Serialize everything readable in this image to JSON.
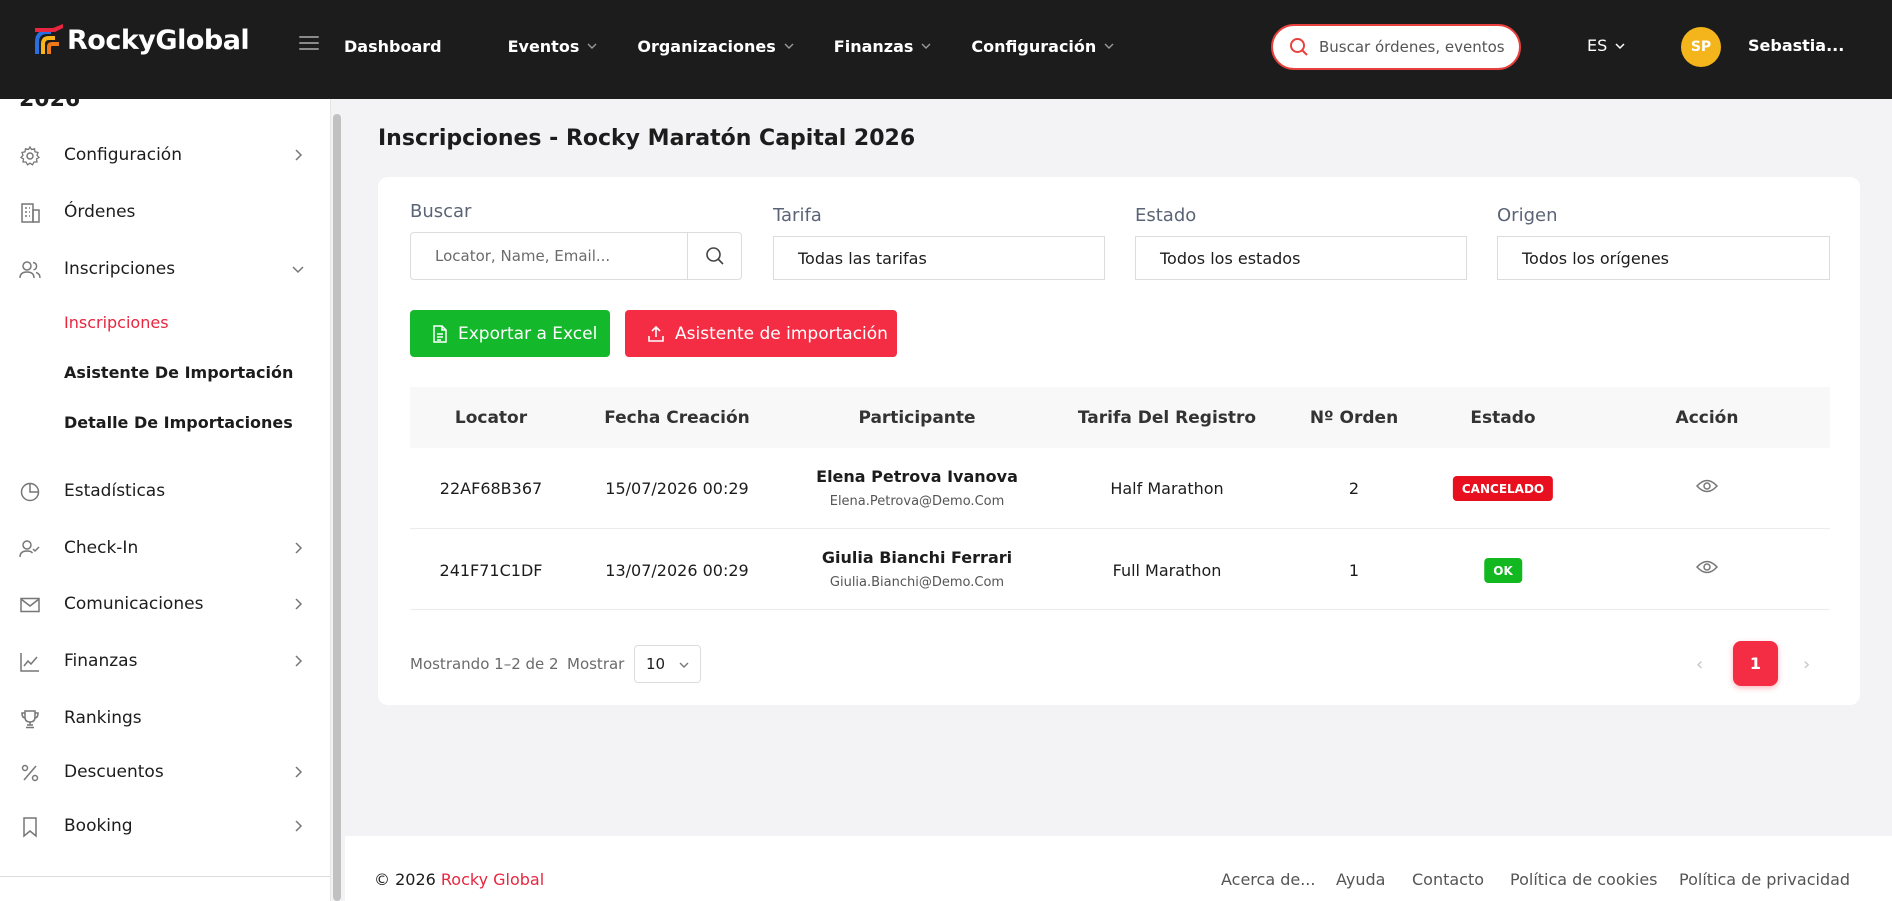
{
  "header": {
    "brand": "RockyGlobal",
    "nav": [
      {
        "label": "Dashboard"
      },
      {
        "label": "Eventos"
      },
      {
        "label": "Organizaciones"
      },
      {
        "label": "Finanzas"
      },
      {
        "label": "Configuración"
      }
    ],
    "search_placeholder": "Buscar órdenes, eventos",
    "language": "ES",
    "avatar_initials": "SP",
    "username": "Sebastia..."
  },
  "sidebar": {
    "cut_title": "2026",
    "items": [
      {
        "label": "Configuración",
        "icon": "gear-icon"
      },
      {
        "label": "Órdenes",
        "icon": "building-icon"
      },
      {
        "label": "Inscripciones",
        "icon": "users-icon"
      },
      {
        "label": "Estadísticas",
        "icon": "pie-chart-icon"
      },
      {
        "label": "Check-In",
        "icon": "user-check-icon"
      },
      {
        "label": "Comunicaciones",
        "icon": "mail-icon"
      },
      {
        "label": "Finanzas",
        "icon": "line-chart-icon"
      },
      {
        "label": "Rankings",
        "icon": "trophy-icon"
      },
      {
        "label": "Descuentos",
        "icon": "percent-icon"
      },
      {
        "label": "Booking",
        "icon": "bookmark-icon"
      }
    ],
    "subitems": [
      {
        "label": "Inscripciones"
      },
      {
        "label": "Asistente De Importación"
      },
      {
        "label": "Detalle De Importaciones"
      }
    ]
  },
  "page": {
    "title": "Inscripciones - Rocky Maratón Capital 2026"
  },
  "filters": {
    "search_label": "Buscar",
    "search_placeholder": "Locator, Name, Email...",
    "tarifa_label": "Tarifa",
    "tarifa_value": "Todas las tarifas",
    "estado_label": "Estado",
    "estado_value": "Todos los estados",
    "origen_label": "Origen",
    "origen_value": "Todos los orígenes"
  },
  "actions": {
    "export_label": "Exportar a Excel",
    "import_label": "Asistente de importación"
  },
  "table": {
    "headers": [
      "Locator",
      "Fecha Creación",
      "Participante",
      "Tarifa Del Registro",
      "Nº Orden",
      "Estado",
      "Acción"
    ],
    "rows": [
      {
        "locator": "22AF68B367",
        "fecha": "15/07/2026 00:29",
        "name": "Elena Petrova Ivanova",
        "email": "Elena.Petrova@Demo.Com",
        "tarifa": "Half Marathon",
        "orden": "2",
        "estado": "CANCELADO"
      },
      {
        "locator": "241F71C1DF",
        "fecha": "13/07/2026 00:29",
        "name": "Giulia Bianchi Ferrari",
        "email": "Giulia.Bianchi@Demo.Com",
        "tarifa": "Full Marathon",
        "orden": "1",
        "estado": "OK"
      }
    ]
  },
  "pagination": {
    "showing": "Mostrando 1–2 de 2",
    "show_label": "Mostrar",
    "per_page": "10",
    "prev": "‹",
    "current": "1",
    "next": "›"
  },
  "footer": {
    "copyright": "© 2026",
    "brand": "Rocky Global",
    "links": [
      "Acerca de...",
      "Ayuda",
      "Contacto",
      "Política de cookies",
      "Política de privacidad"
    ]
  },
  "colors": {
    "accent": "#f52d44",
    "success": "#14b82b",
    "topbar": "#1c1c1c",
    "avatar": "#f4b51c"
  }
}
